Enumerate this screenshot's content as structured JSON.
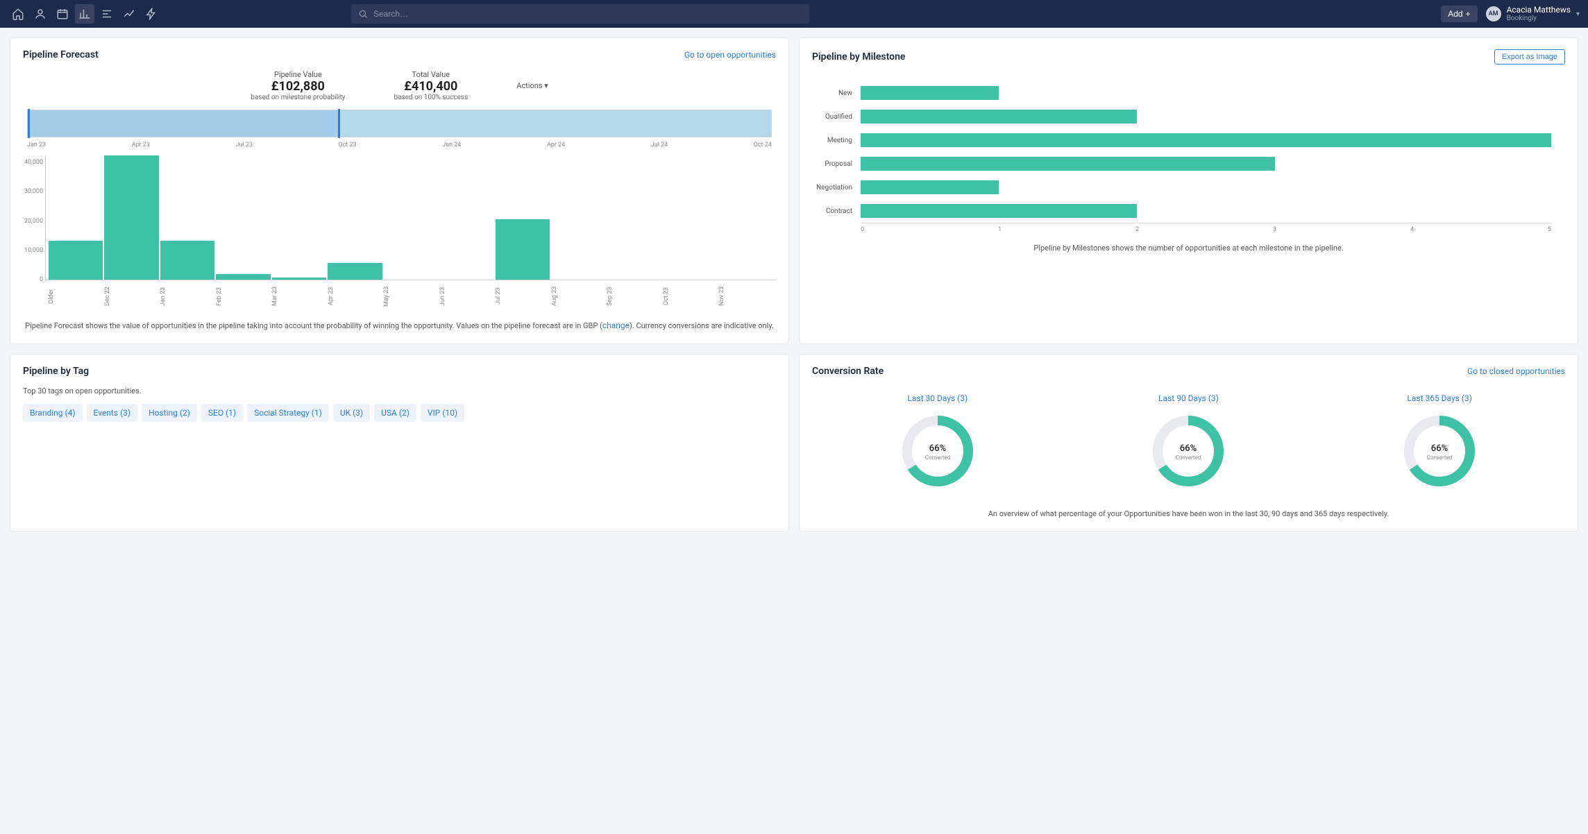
{
  "nav": {
    "search_placeholder": "Search…",
    "add_label": "Add",
    "user_name": "Acacia Matthews",
    "org_name": "Bookingly",
    "avatar_initials": "AM"
  },
  "forecast": {
    "title": "Pipeline Forecast",
    "link": "Go to open opportunities",
    "pipeline_value_label": "Pipeline Value",
    "pipeline_value": "£102,880",
    "pipeline_value_sub": "based on milestone probability",
    "total_value_label": "Total Value",
    "total_value": "£410,400",
    "total_value_sub": "based on 100% success",
    "actions_label": "Actions",
    "brush_ticks": [
      "Jan 23",
      "Apr 23",
      "Jul 23",
      "Oct 23",
      "Jan 24",
      "Apr 24",
      "Jul 24",
      "Oct 24"
    ],
    "desc_pre": "Pipeline Forecast shows the value of opportunities in the pipeline taking into account the probability of winning the opportunity. Values on the pipeline forecast are in GBP (",
    "desc_link": "change",
    "desc_post": "). Currency conversions are indicative only."
  },
  "milestone": {
    "title": "Pipeline by Milestone",
    "export_label": "Export as Image",
    "desc": "Pipeline by Milestones shows the number of opportunities at each milestone in the pipeline."
  },
  "tags": {
    "title": "Pipeline by Tag",
    "desc": "Top 30 tags on open opportunities.",
    "items": [
      "Branding (4)",
      "Events (3)",
      "Hosting (2)",
      "SEO (1)",
      "Social Strategy (1)",
      "UK (3)",
      "USA (2)",
      "VIP (10)"
    ]
  },
  "conversion": {
    "title": "Conversion Rate",
    "link": "Go to closed opportunities",
    "desc": "An overview of what percentage of your Opportunities have been won in the last 30, 90 days and 365 days respectively.",
    "periods": [
      {
        "label": "Last 30 Days (3)",
        "pct": 66,
        "pct_label": "66%",
        "sub": "Converted"
      },
      {
        "label": "Last 90 Days (3)",
        "pct": 66,
        "pct_label": "66%",
        "sub": "Converted"
      },
      {
        "label": "Last 365 Days (3)",
        "pct": 66,
        "pct_label": "66%",
        "sub": "Converted"
      }
    ]
  },
  "chart_data": [
    {
      "type": "bar",
      "title": "Pipeline Forecast",
      "ylabel": "",
      "ylim": [
        0,
        45000
      ],
      "yticks": [
        0,
        10000,
        20000,
        30000,
        40000
      ],
      "categories": [
        "Older",
        "Dec 22",
        "Jan 23",
        "Feb 23",
        "Mar 23",
        "Apr 23",
        "May 23",
        "Jun 23",
        "Jul 23",
        "Aug 23",
        "Sep 23",
        "Oct 23",
        "Nov 23"
      ],
      "values": [
        14000,
        45000,
        14000,
        2000,
        800,
        6000,
        0,
        0,
        22000,
        0,
        0,
        0,
        0
      ]
    },
    {
      "type": "bar",
      "orientation": "horizontal",
      "title": "Pipeline by Milestone",
      "xlim": [
        0,
        5
      ],
      "xticks": [
        0,
        1,
        2,
        3,
        4,
        5
      ],
      "categories": [
        "New",
        "Qualified",
        "Meeting",
        "Proposal",
        "Negotiation",
        "Contract"
      ],
      "values": [
        1,
        2,
        5,
        3,
        1,
        2
      ]
    },
    {
      "type": "pie",
      "title": "Conversion Rate",
      "series": [
        {
          "name": "Last 30 Days (3)",
          "values": [
            66,
            34
          ]
        },
        {
          "name": "Last 90 Days (3)",
          "values": [
            66,
            34
          ]
        },
        {
          "name": "Last 365 Days (3)",
          "values": [
            66,
            34
          ]
        }
      ]
    }
  ]
}
